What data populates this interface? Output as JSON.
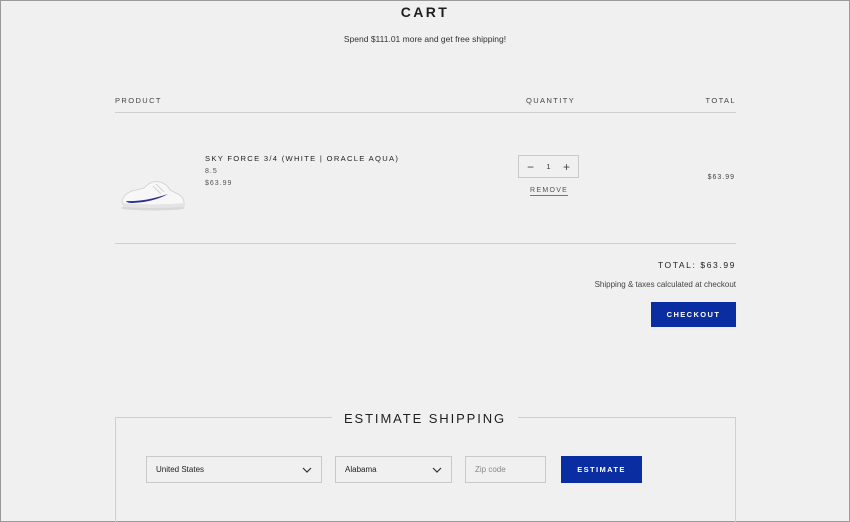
{
  "page": {
    "title": "CART",
    "promo": "Spend $111.01 more and get free shipping!"
  },
  "table": {
    "headers": {
      "product": "PRODUCT",
      "quantity": "QUANTITY",
      "total": "TOTAL"
    }
  },
  "items": [
    {
      "name": "SKY FORCE 3/4 (WHITE | ORACLE AQUA)",
      "size": "8.5",
      "price": "$63.99",
      "quantity": "1",
      "remove_label": "REMOVE",
      "line_total": "$63.99",
      "image_icon": "sneaker-image"
    }
  ],
  "summary": {
    "total": "TOTAL: $63.99",
    "shipping_note": "Shipping & taxes calculated at checkout",
    "checkout_label": "CHECKOUT"
  },
  "estimate": {
    "title": "ESTIMATE SHIPPING",
    "country": "United States",
    "state": "Alabama",
    "zip_placeholder": "Zip code",
    "button_label": "ESTIMATE"
  },
  "colors": {
    "background": "#f0f0f0",
    "accent": "#0a2ea1",
    "divider": "#cfcfcf"
  }
}
